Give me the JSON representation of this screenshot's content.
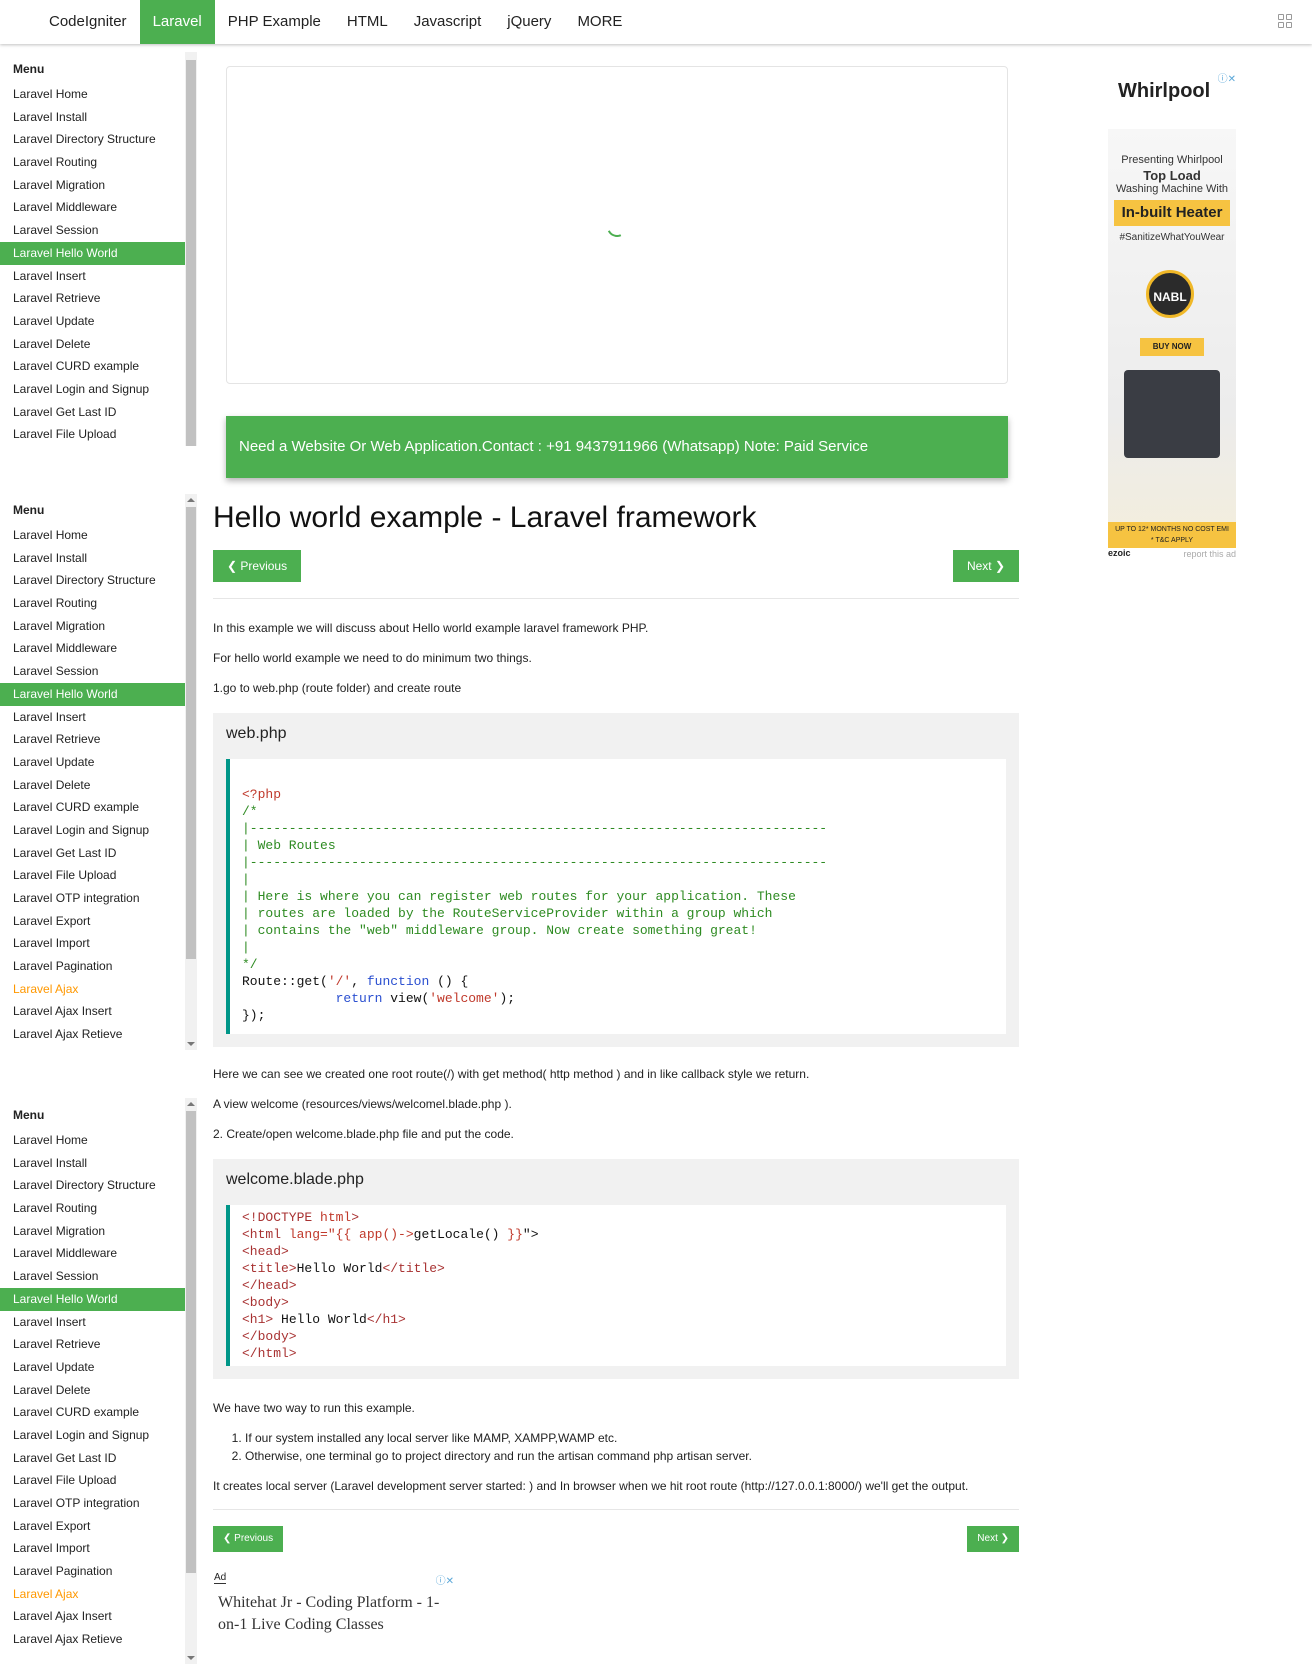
{
  "topnav": {
    "items": [
      "CodeIgniter",
      "Laravel",
      "PHP Example",
      "HTML",
      "Javascript",
      "jQuery",
      "MORE"
    ],
    "active": "Laravel"
  },
  "sidebar": {
    "heading": "Menu",
    "items_short": [
      "Laravel Home",
      "Laravel Install",
      "Laravel Directory Structure",
      "Laravel Routing",
      "Laravel Migration",
      "Laravel Middleware",
      "Laravel Session",
      "Laravel Hello World",
      "Laravel Insert",
      "Laravel Retrieve",
      "Laravel Update",
      "Laravel Delete",
      "Laravel CURD example",
      "Laravel Login and Signup",
      "Laravel Get Last ID",
      "Laravel File Upload"
    ],
    "items_long": [
      "Laravel Home",
      "Laravel Install",
      "Laravel Directory Structure",
      "Laravel Routing",
      "Laravel Migration",
      "Laravel Middleware",
      "Laravel Session",
      "Laravel Hello World",
      "Laravel Insert",
      "Laravel Retrieve",
      "Laravel Update",
      "Laravel Delete",
      "Laravel CURD example",
      "Laravel Login and Signup",
      "Laravel Get Last ID",
      "Laravel File Upload",
      "Laravel OTP integration",
      "Laravel Export",
      "Laravel Import",
      "Laravel Pagination",
      "Laravel Ajax",
      "Laravel Ajax Insert",
      "Laravel Ajax Retieve"
    ],
    "active_item": "Laravel Hello World",
    "highlight_item": "Laravel Ajax"
  },
  "banner": {
    "text": "Need a Website Or Web Application.Contact : +91 9437911966 (Whatsapp) Note: Paid Service"
  },
  "article": {
    "title": "Hello world example - Laravel framework",
    "prev_label": "❮ Previous",
    "next_label": "Next ❯",
    "p1": "In this example we will discuss about Hello world example laravel framework PHP.",
    "p2": "For hello world example we need to do minimum two things.",
    "p3": "1.go to web.php (route folder) and create route",
    "code1_title": "web.php",
    "p4": "Here we can see we created one root route(/) with get method( http method ) and in like callback style we return.",
    "p5": "A view welcome (resources/views/welcomel.blade.php ).",
    "p6": "2. Create/open welcome.blade.php file and put the code.",
    "code2_title": "welcome.blade.php",
    "p7": "We have two way to run this example.",
    "list": [
      "If our system installed any local server like MAMP, XAMPP,WAMP etc.",
      "Otherwise, one terminal go to project directory and run the artisan command php artisan server."
    ],
    "p8": "It creates local server (Laravel development server started: ) and In browser when we hit root route (http://127.0.0.1:8000/) we'll get the output."
  },
  "right_ad": {
    "brand": "Whirlpool",
    "line1": "Presenting Whirlpool",
    "line2": "Top Load",
    "line3": "Washing Machine With",
    "heater": "In-built Heater",
    "hashtag": "#SanitizeWhatYouWear",
    "badge": "NABL",
    "buy": "BUY NOW",
    "emi1": "UP TO 12* MONTHS NO COST EMI",
    "emi2": "* T&C APPLY",
    "ezoic": "ezoic",
    "report": "report this ad"
  },
  "bottom_ad": {
    "label": "Ad",
    "headline": "Whitehat Jr - Coding Platform - 1-on-1 Live Coding Classes"
  },
  "colors": {
    "accent": "#4caf50",
    "code_border": "#009688",
    "highlight": "#ff9800"
  },
  "icons": [
    "apps-grid-icon",
    "spinner-icon",
    "ad-choices-icon",
    "close-icon"
  ]
}
